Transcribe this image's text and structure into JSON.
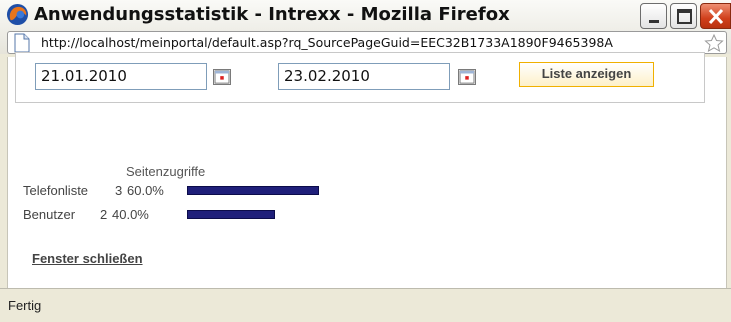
{
  "window": {
    "title": "Anwendungsstatistik - Intrexx - Mozilla Firefox",
    "url": "http://localhost/meinportal/default.asp?rq_SourcePageGuid=EEC32B1733A1890F9465398A"
  },
  "form": {
    "date_from": "21.01.2010",
    "date_to": "23.02.2010",
    "list_button": "Liste anzeigen"
  },
  "chart_data": {
    "type": "bar",
    "title": "Seitenzugriffe",
    "categories": [
      "Telefonliste",
      "Benutzer"
    ],
    "values": [
      3,
      2
    ],
    "percent_labels": [
      "60.0%",
      "40.0%"
    ],
    "bar_color": "#1f1f7a"
  },
  "close_link": "Fenster schließen",
  "status": "Fertig"
}
